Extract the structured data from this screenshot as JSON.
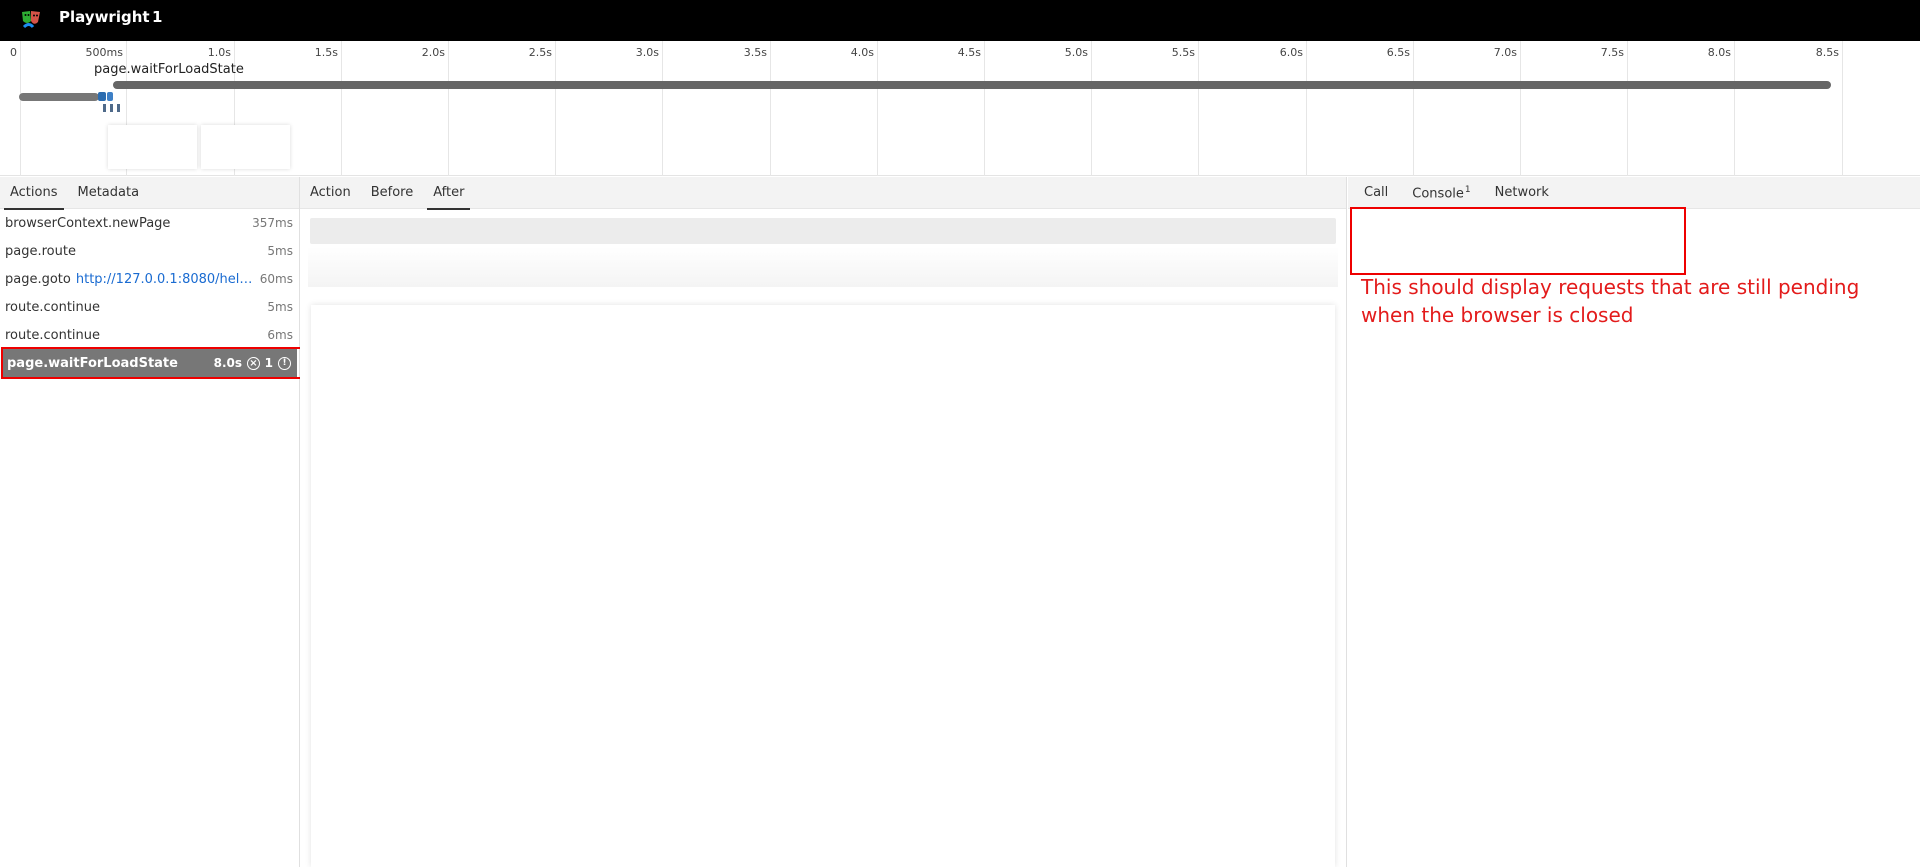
{
  "header": {
    "title": "Playwright",
    "count": "1"
  },
  "timeline": {
    "ticks": [
      "0",
      "500ms",
      "1.0s",
      "1.5s",
      "2.0s",
      "2.5s",
      "3.0s",
      "3.5s",
      "4.0s",
      "4.5s",
      "5.0s",
      "5.5s",
      "6.0s",
      "6.5s",
      "7.0s",
      "7.5s",
      "8.0s",
      "8.5s"
    ],
    "action_label": "page.waitForLoadState"
  },
  "left": {
    "tabs": [
      "Actions",
      "Metadata"
    ],
    "actions": [
      {
        "title": "browserContext.newPage",
        "url": "",
        "duration": "357ms"
      },
      {
        "title": "page.route",
        "url": "",
        "duration": "5ms"
      },
      {
        "title": "page.goto",
        "url": "http://127.0.0.1:8080/hello....",
        "duration": "60ms"
      },
      {
        "title": "route.continue",
        "url": "",
        "duration": "5ms"
      },
      {
        "title": "route.continue",
        "url": "",
        "duration": "6ms"
      }
    ],
    "selected": {
      "title": "page.waitForLoadState",
      "duration": "8.0s",
      "error_count": "1"
    }
  },
  "middle": {
    "tabs": [
      "Action",
      "Before",
      "After"
    ]
  },
  "right": {
    "tabs": {
      "call": "Call",
      "console": "Console",
      "console_badge": "1",
      "network": "Network"
    },
    "annotation": "This should display requests that are still pending when the browser is closed"
  },
  "colors": {
    "highlight": "#e00000",
    "link": "#1a6bd1",
    "header_bg": "#000000"
  }
}
